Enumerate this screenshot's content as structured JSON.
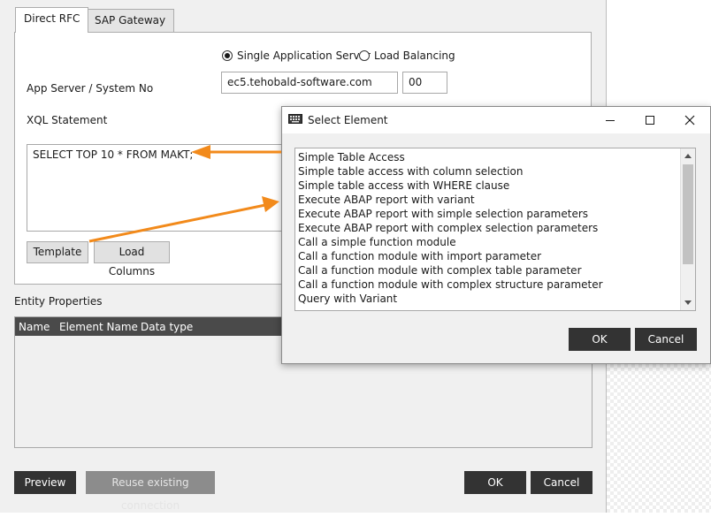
{
  "tabs": [
    {
      "label": "Direct RFC",
      "active": true
    },
    {
      "label": "SAP Gateway",
      "active": false
    }
  ],
  "connection": {
    "single_server_label": "Single Application Server",
    "load_balancing_label": "Load Balancing",
    "selected": "Single Application Server",
    "app_server_label": "App Server / System No",
    "app_server_value": "ec5.tehobald-software.com",
    "system_no_value": "00"
  },
  "xql": {
    "label": "XQL Statement",
    "value": "SELECT TOP 10 * FROM MAKT;",
    "template_button": "Template",
    "load_columns_button": "Load Columns"
  },
  "entity": {
    "section_label": "Entity Properties",
    "columns": [
      "Name",
      "Element Name",
      "Data type"
    ],
    "rows": []
  },
  "footer": {
    "preview_button": "Preview",
    "reuse_button": "Reuse existing connection",
    "ok_button": "OK",
    "cancel_button": "Cancel"
  },
  "dialog": {
    "title": "Select Element",
    "items": [
      "Simple Table Access",
      "Simple table access with column selection",
      "Simple table access with WHERE clause",
      "Execute ABAP report with variant",
      "Execute ABAP report with simple selection parameters",
      "Execute ABAP report with complex selection parameters",
      "Call a simple function module",
      "Call a function module with import parameter",
      "Call a function module with complex table parameter",
      "Call a function module with complex structure parameter",
      "Query with Variant"
    ],
    "ok_button": "OK",
    "cancel_button": "Cancel"
  },
  "colors": {
    "arrow": "#f28a1b",
    "dark_button": "#333333",
    "grid_header": "#4a4a4a"
  }
}
